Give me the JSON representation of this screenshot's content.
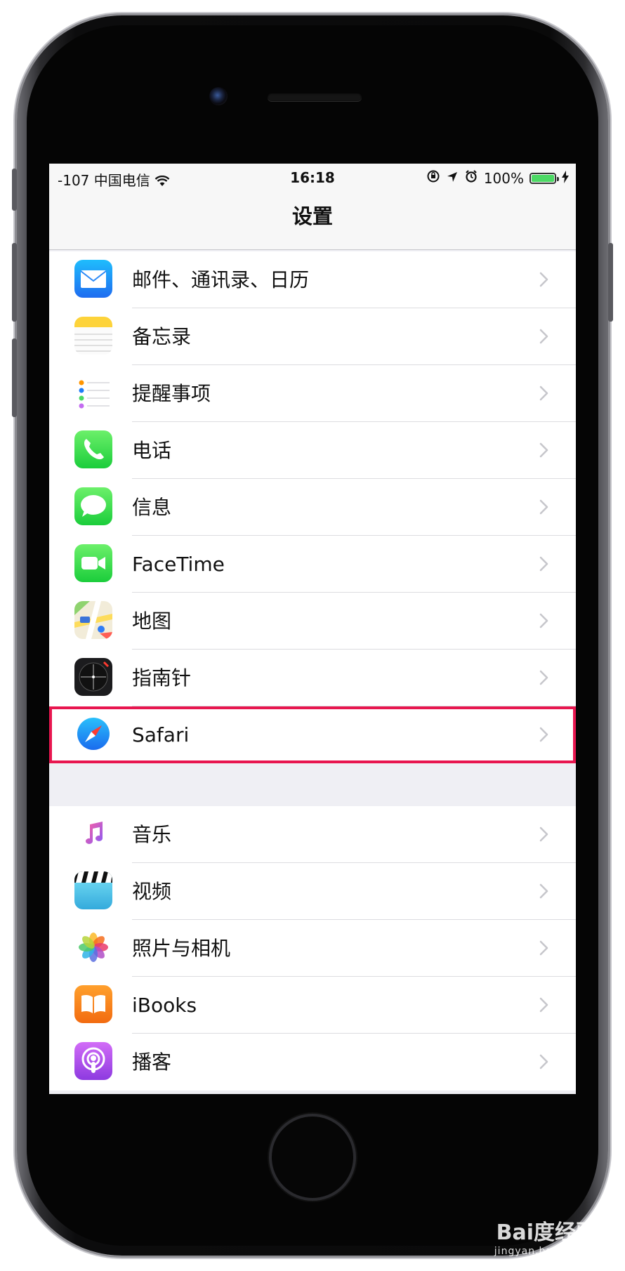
{
  "status_bar": {
    "signal": "-107",
    "carrier": "中国电信",
    "time": "16:18",
    "battery_percent": "100%",
    "battery_level": 1.0
  },
  "nav": {
    "title": "设置"
  },
  "groups": [
    {
      "items": [
        {
          "label": "邮件、通讯录、日历",
          "icon": "mail-icon"
        },
        {
          "label": "备忘录",
          "icon": "notes-icon"
        },
        {
          "label": "提醒事项",
          "icon": "reminders-icon"
        },
        {
          "label": "电话",
          "icon": "phone-icon"
        },
        {
          "label": "信息",
          "icon": "messages-icon"
        },
        {
          "label": "FaceTime",
          "icon": "facetime-icon"
        },
        {
          "label": "地图",
          "icon": "maps-icon"
        },
        {
          "label": "指南针",
          "icon": "compass-icon"
        },
        {
          "label": "Safari",
          "icon": "safari-icon",
          "highlighted": true
        }
      ]
    },
    {
      "items": [
        {
          "label": "音乐",
          "icon": "music-icon"
        },
        {
          "label": "视频",
          "icon": "videos-icon"
        },
        {
          "label": "照片与相机",
          "icon": "photos-icon"
        },
        {
          "label": "iBooks",
          "icon": "ibooks-icon"
        },
        {
          "label": "播客",
          "icon": "podcasts-icon"
        }
      ]
    }
  ],
  "colors": {
    "highlight": "#e8164f",
    "accent": "#007aff",
    "battery": "#4cd964"
  },
  "watermark": {
    "text": "Bai度经验",
    "sub": "jingyan.baidu.com"
  }
}
